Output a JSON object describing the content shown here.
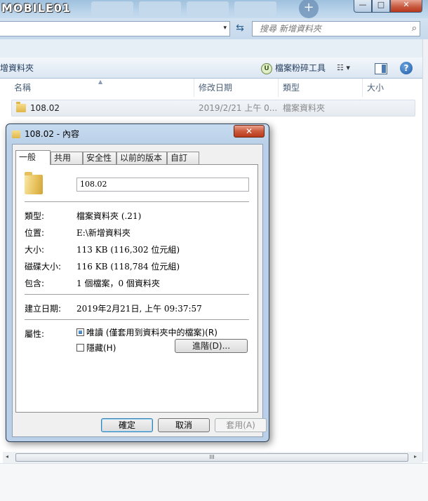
{
  "watermark": "MOBILE01",
  "address": {
    "search_placeholder": "搜尋 新增資料夾",
    "dropdown_glyph": "▾",
    "refresh_glyph": "⇆",
    "search_glyph": "⌕"
  },
  "toolbar": {
    "breadcrumb": "增資料夾",
    "shred_label": "檔案粉碎工具",
    "shred_glyph": "U",
    "view_glyph": "☷ ▾",
    "help_glyph": "?"
  },
  "window_buttons": {
    "min": "—",
    "max": "□",
    "close": "✕"
  },
  "columns": [
    "名稱",
    "修改日期",
    "類型",
    "大小"
  ],
  "files": [
    {
      "name": "108.02",
      "modified": "2019/2/21 上午 0...",
      "type": "檔案資料夾"
    }
  ],
  "scroll": {
    "left": "◂",
    "right": "▸",
    "grip": "III"
  },
  "dialog": {
    "title": "108.02 - 內容",
    "close_glyph": "✕",
    "tabs": [
      "一般",
      "共用",
      "安全性",
      "以前的版本",
      "自訂"
    ],
    "active_tab": "一般",
    "folder_name": "108.02",
    "properties": [
      {
        "label": "類型:",
        "value": "檔案資料夾 (.21)"
      },
      {
        "label": "位置:",
        "value": "E:\\新增資料夾"
      },
      {
        "label": "大小:",
        "value": "113 KB (116,302 位元組)"
      },
      {
        "label": "磁碟大小:",
        "value": "116 KB (118,784 位元組)"
      },
      {
        "label": "包含:",
        "value": "1 個檔案，0 個資料夾"
      }
    ],
    "created": {
      "label": "建立日期:",
      "value": "2019年2月21日, 上午 09:37:57"
    },
    "attributes": {
      "label": "屬性:",
      "readonly": "唯讀 (僅套用到資料夾中的檔案)(R)",
      "hidden": "隱藏(H)",
      "advanced": "進階(D)..."
    },
    "buttons": {
      "ok": "確定",
      "cancel": "取消",
      "apply": "套用(A)"
    }
  }
}
